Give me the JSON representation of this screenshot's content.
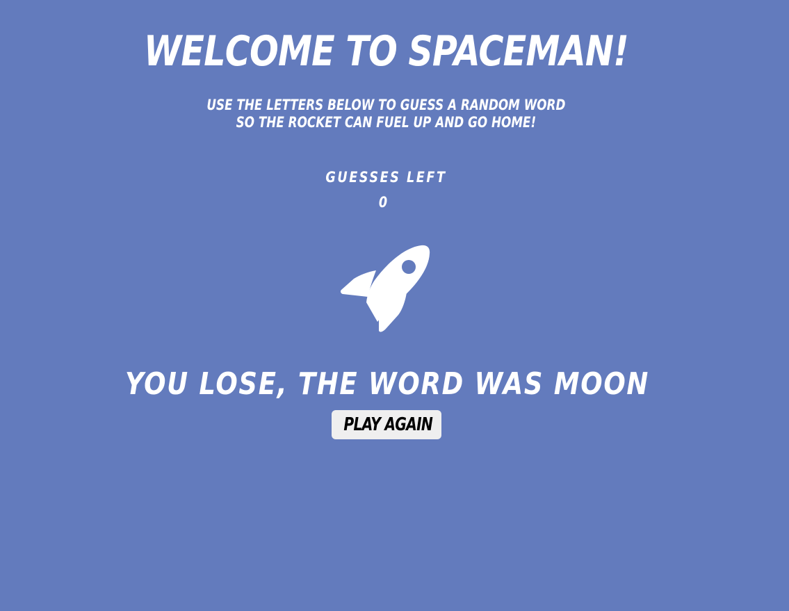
{
  "header": {
    "title": "WELCOME TO SPACEMAN!",
    "subtitle_line1": "USE THE LETTERS BELOW TO GUESS A RANDOM WORD",
    "subtitle_line2": "SO THE ROCKET CAN FUEL UP AND GO HOME!"
  },
  "status": {
    "guesses_label": "GUESSES LEFT",
    "guesses_left": "0",
    "result_message": "YOU LOSE, THE WORD WAS MOON"
  },
  "controls": {
    "play_again_label": "PLAY AGAIN"
  },
  "icons": {
    "rocket": "rocket-icon"
  },
  "colors": {
    "background": "#637bbd",
    "text": "#ffffff",
    "button_background": "#efefef",
    "button_text": "#000000"
  }
}
